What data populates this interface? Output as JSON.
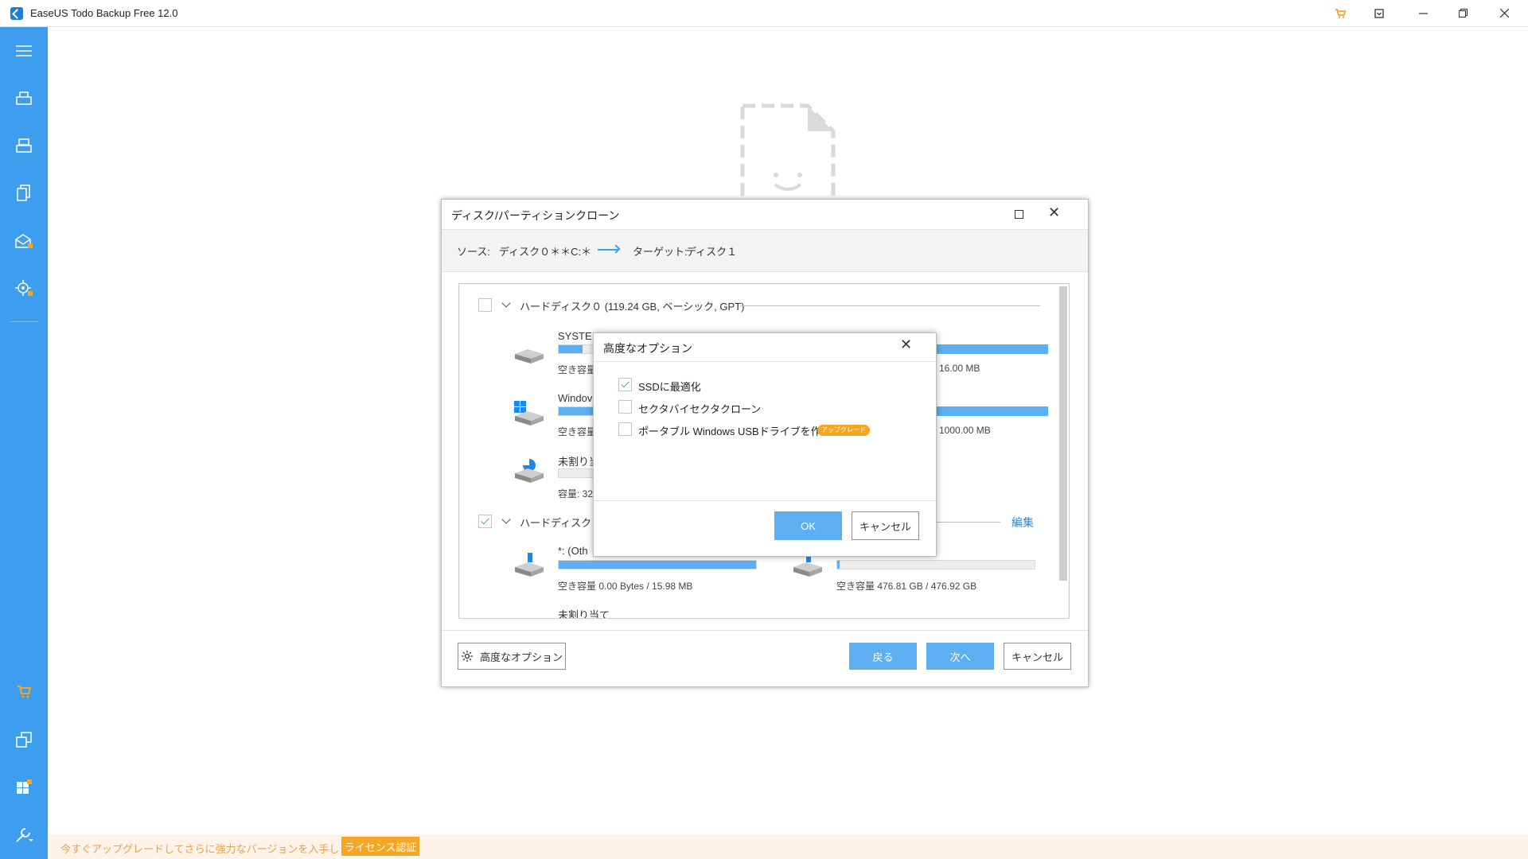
{
  "app": {
    "title": "EaseUS Todo Backup Free 12.0"
  },
  "titlebar": {
    "icons": [
      "cart-icon",
      "feedback-icon",
      "minimize-icon",
      "restore-icon",
      "close-icon"
    ]
  },
  "sidebar": {
    "icons": [
      "menu-icon",
      "disk-backup-icon",
      "system-backup-icon",
      "file-backup-icon",
      "mail-backup-icon",
      "smart-backup-icon",
      "cart-icon",
      "clone-icon",
      "windows-icon",
      "tools-icon"
    ],
    "accent": "#3d9ef0"
  },
  "dialog": {
    "title": "ディスク/パーティションクローン",
    "source_label": "ソース:",
    "source_value": "ディスク０＊＊C:＊",
    "target_label": "ターゲット:",
    "target_value": "ディスク１",
    "disks": [
      {
        "title": "ハードディスク０ (119.24 GB, ベーシック, GPT)",
        "checked": false,
        "partitions": [
          {
            "name": "SYSTE",
            "info": "空き容量",
            "info_right": "16.00 MB",
            "fill": 0.09
          },
          {
            "name": "Windov",
            "info": "空き容量",
            "info_right": "1000.00 MB",
            "fill": 0.15
          },
          {
            "name": "未割り当",
            "info": "容量: 32",
            "fill": 0.0
          }
        ]
      },
      {
        "title": "ハードディスク１",
        "checked": true,
        "edit_label": "編集",
        "partitions": [
          {
            "name": "*: (Oth",
            "info": "空き容量 0.00 Bytes / 15.98 MB",
            "fill": 1.0
          },
          {
            "name": "",
            "info": "空き容量 476.81 GB / 476.92 GB",
            "fill": 0.01
          },
          {
            "name": "未割り当て",
            "info": "",
            "fill": 0.0
          }
        ]
      }
    ],
    "advanced_button": "高度なオプション",
    "back_button": "戻る",
    "next_button": "次へ",
    "cancel_button": "キャンセル"
  },
  "modal": {
    "title": "高度なオプション",
    "options": [
      {
        "label": "SSDに最適化",
        "checked": true
      },
      {
        "label": "セクタバイセクタクローン",
        "checked": false
      },
      {
        "label": "ポータブル Windows USBドライブを作成",
        "checked": false,
        "badge": "アップグレード"
      }
    ],
    "ok_button": "OK",
    "cancel_button": "キャンセル"
  },
  "banner": {
    "text": "今すぐアップグレードしてさらに強力なバージョンを入手しましょう。",
    "license_button": "ライセンス認証"
  }
}
